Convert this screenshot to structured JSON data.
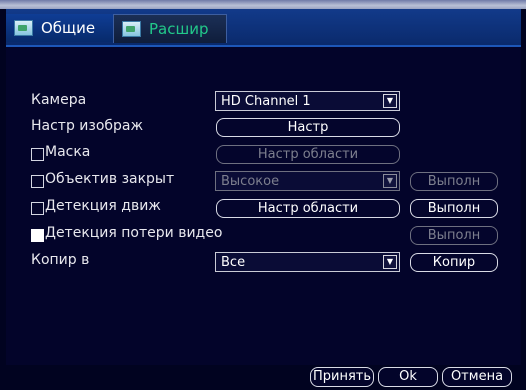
{
  "tabs": [
    {
      "label": "Общие",
      "active": false
    },
    {
      "label": "Расшир",
      "active": true
    }
  ],
  "form": {
    "camera": {
      "label": "Камера",
      "value": "HD Channel 1"
    },
    "image_settings": {
      "label": "Настр изображ",
      "button": "Настр"
    },
    "mask": {
      "label": "Маска",
      "checked": false,
      "button": "Настр области"
    },
    "lens_closed": {
      "label": "Объектив закрыт",
      "checked": false,
      "value": "Высокое",
      "button": "Выполн"
    },
    "motion_detect": {
      "label": "Детекция движ",
      "checked": false,
      "button": "Настр области",
      "button2": "Выполн"
    },
    "video_loss": {
      "label": "Детекция потери видео",
      "checked": true,
      "button": "Выполн"
    },
    "copy_to": {
      "label": "Копир в",
      "value": "Все",
      "button": "Копир"
    }
  },
  "footer": {
    "apply": "Принять",
    "ok": "Ok",
    "cancel": "Отмена"
  },
  "colors": {
    "background": "#03042a",
    "tabbar": "#0f3d95",
    "active_tab_text": "#22c98a",
    "text": "#e8e8ee",
    "disabled_text": "#7d7f8e"
  }
}
